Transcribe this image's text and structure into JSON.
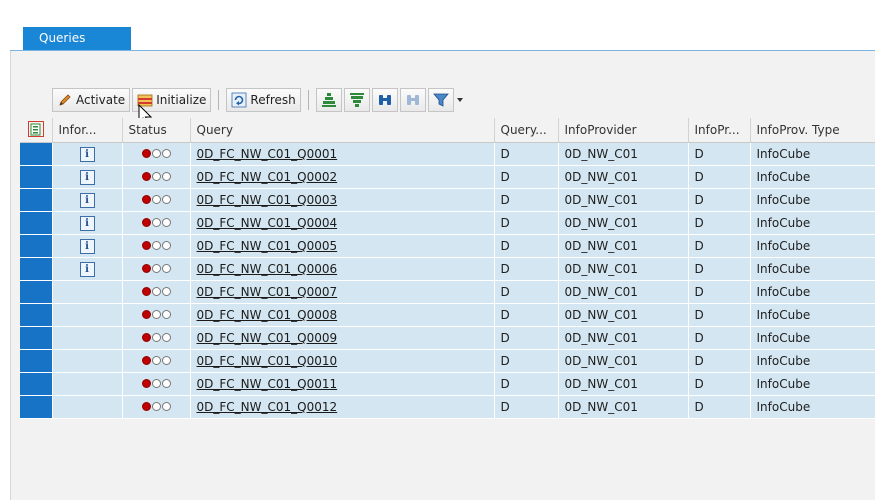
{
  "tabs": [
    {
      "label": "Queries"
    }
  ],
  "toolbar": {
    "activate_label": "Activate",
    "initialize_label": "Initialize",
    "refresh_label": "Refresh"
  },
  "columns": [
    "Infor...",
    "Status",
    "Query",
    "Query...",
    "InfoProvider",
    "InfoPr...",
    "InfoProv. Type"
  ],
  "rows": [
    {
      "info": true,
      "status": "red",
      "query": "0D_FC_NW_C01_Q0001",
      "qtype": "D",
      "provider": "0D_NW_C01",
      "ptype": "D",
      "ptypename": "InfoCube"
    },
    {
      "info": true,
      "status": "red",
      "query": "0D_FC_NW_C01_Q0002",
      "qtype": "D",
      "provider": "0D_NW_C01",
      "ptype": "D",
      "ptypename": "InfoCube"
    },
    {
      "info": true,
      "status": "red",
      "query": "0D_FC_NW_C01_Q0003",
      "qtype": "D",
      "provider": "0D_NW_C01",
      "ptype": "D",
      "ptypename": "InfoCube"
    },
    {
      "info": true,
      "status": "red",
      "query": "0D_FC_NW_C01_Q0004",
      "qtype": "D",
      "provider": "0D_NW_C01",
      "ptype": "D",
      "ptypename": "InfoCube"
    },
    {
      "info": true,
      "status": "red",
      "query": "0D_FC_NW_C01_Q0005",
      "qtype": "D",
      "provider": "0D_NW_C01",
      "ptype": "D",
      "ptypename": "InfoCube"
    },
    {
      "info": true,
      "status": "red",
      "query": "0D_FC_NW_C01_Q0006",
      "qtype": "D",
      "provider": "0D_NW_C01",
      "ptype": "D",
      "ptypename": "InfoCube"
    },
    {
      "info": false,
      "status": "red",
      "query": "0D_FC_NW_C01_Q0007",
      "qtype": "D",
      "provider": "0D_NW_C01",
      "ptype": "D",
      "ptypename": "InfoCube"
    },
    {
      "info": false,
      "status": "red",
      "query": "0D_FC_NW_C01_Q0008",
      "qtype": "D",
      "provider": "0D_NW_C01",
      "ptype": "D",
      "ptypename": "InfoCube"
    },
    {
      "info": false,
      "status": "red",
      "query": "0D_FC_NW_C01_Q0009",
      "qtype": "D",
      "provider": "0D_NW_C01",
      "ptype": "D",
      "ptypename": "InfoCube"
    },
    {
      "info": false,
      "status": "red",
      "query": "0D_FC_NW_C01_Q0010",
      "qtype": "D",
      "provider": "0D_NW_C01",
      "ptype": "D",
      "ptypename": "InfoCube"
    },
    {
      "info": false,
      "status": "red",
      "query": "0D_FC_NW_C01_Q0011",
      "qtype": "D",
      "provider": "0D_NW_C01",
      "ptype": "D",
      "ptypename": "InfoCube"
    },
    {
      "info": false,
      "status": "red",
      "query": "0D_FC_NW_C01_Q0012",
      "qtype": "D",
      "provider": "0D_NW_C01",
      "ptype": "D",
      "ptypename": "InfoCube"
    }
  ],
  "info_glyph": "i",
  "icons": {
    "activate": "pencil-icon",
    "initialize": "initialize-icon",
    "refresh": "refresh-icon",
    "sort_asc": "sort-ascending-icon",
    "sort_desc": "sort-descending-icon",
    "find": "binoculars-icon",
    "find_next": "find-next-icon",
    "filter": "filter-icon",
    "layout": "select-layout-icon"
  },
  "colors": {
    "tab": "#1a86d6",
    "row": "#d4e6f1",
    "row_selector": "#1673c6",
    "status_red": "#c00000"
  }
}
